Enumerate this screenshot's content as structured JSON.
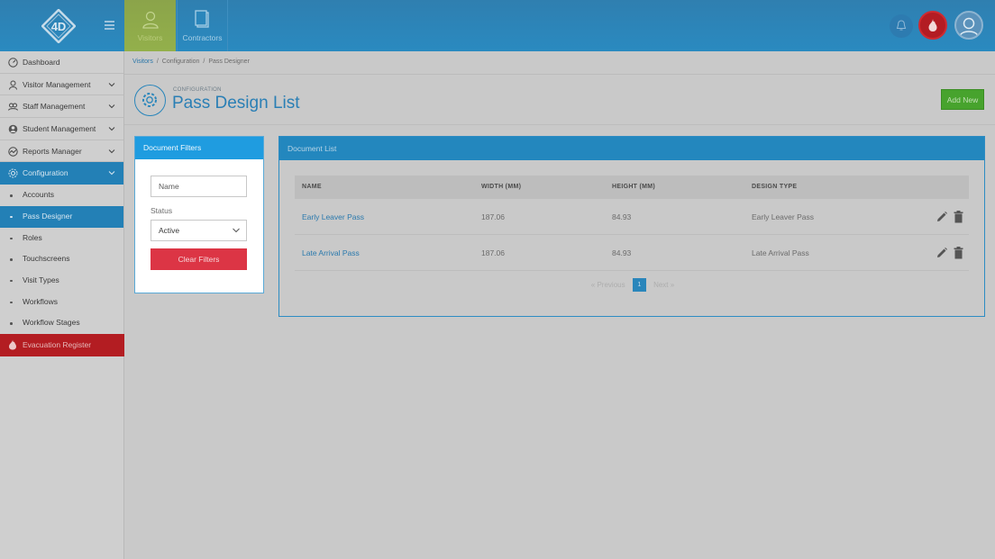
{
  "topbar": {
    "tabs": [
      {
        "label": "Visitors",
        "icon": "visitor-icon"
      },
      {
        "label": "Contractors",
        "icon": "document-icon"
      }
    ],
    "logo_text": "4D"
  },
  "sidebar": {
    "items": [
      {
        "label": "Dashboard",
        "icon": "dashboard-icon"
      },
      {
        "label": "Visitor Management",
        "icon": "user-icon"
      },
      {
        "label": "Staff Management",
        "icon": "staff-icon"
      },
      {
        "label": "Student Management",
        "icon": "student-icon"
      },
      {
        "label": "Reports Manager",
        "icon": "reports-icon"
      },
      {
        "label": "Configuration",
        "icon": "gear-icon"
      }
    ],
    "sub_items": [
      "Accounts",
      "Pass Designer",
      "Roles",
      "Touchscreens",
      "Visit Types",
      "Workflows",
      "Workflow Stages"
    ],
    "evacuation": "Evacuation Register"
  },
  "breadcrumb": {
    "home": "Visitors",
    "sep": "/",
    "mid": "Configuration",
    "current": "Pass Designer"
  },
  "header": {
    "subtitle": "CONFIGURATION",
    "title": "Pass Design List",
    "add_label": "Add New"
  },
  "filters": {
    "title": "Document Filters",
    "name_placeholder": "Name",
    "status_label": "Status",
    "status_value": "Active",
    "clear_label": "Clear Filters"
  },
  "doc_list": {
    "title": "Document List",
    "columns": [
      "NAME",
      "WIDTH (MM)",
      "HEIGHT (MM)",
      "DESIGN TYPE"
    ],
    "rows": [
      {
        "name": "Early Leaver Pass",
        "width": "187.06",
        "height": "84.93",
        "type": "Early Leaver Pass"
      },
      {
        "name": "Late Arrival Pass",
        "width": "187.06",
        "height": "84.93",
        "type": "Late Arrival Pass"
      }
    ],
    "pager": {
      "prev": "« Previous",
      "page": "1",
      "next": "Next »"
    }
  },
  "colors": {
    "primary": "#2380b6",
    "success": "#47a32d",
    "danger": "#dc3545",
    "filter_head": "#1f9ce0"
  }
}
